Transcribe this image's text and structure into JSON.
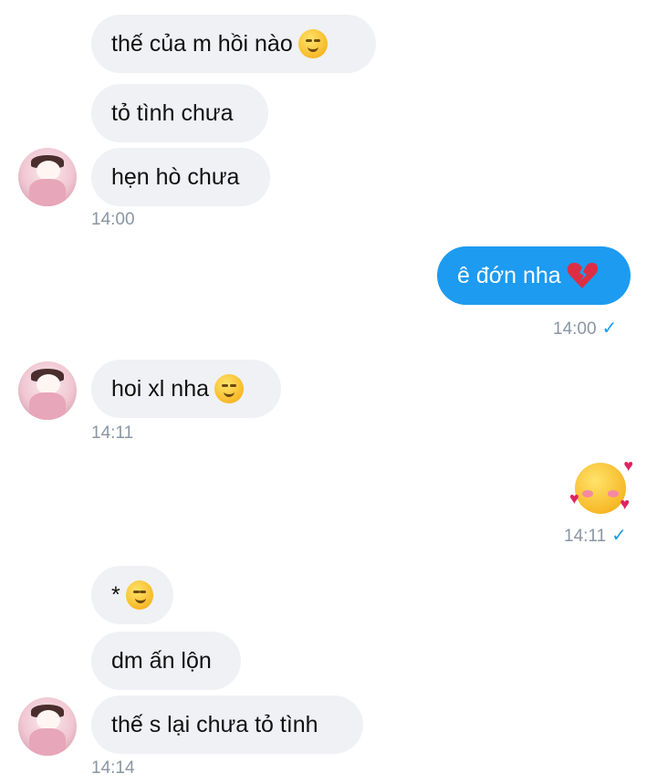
{
  "messages": {
    "m1": "thế của m hồi nào",
    "m2": "tỏ tình chưa",
    "m3": "hẹn hò chưa",
    "t1": "14:00",
    "m4": "ê đớn nha",
    "t2": "14:00",
    "m5": "hoi xl nha",
    "t3": "14:11",
    "t4": "14:11",
    "m6": "*",
    "m7": "dm ấn lộn",
    "m8": "thế s lại chưa tỏ tình",
    "t5": "14:14"
  },
  "icons": {
    "smirk": "smirking-face-icon",
    "broken_heart": "broken-heart-icon",
    "rofl": "rolling-laughing-face-icon",
    "hearts_face": "smiling-face-with-hearts-icon",
    "crying": "crying-face-icon",
    "read": "check-icon"
  },
  "colors": {
    "incoming_bubble": "#eff1f4",
    "outgoing_bubble": "#1d9bf0",
    "timestamp": "#8b96a3"
  }
}
